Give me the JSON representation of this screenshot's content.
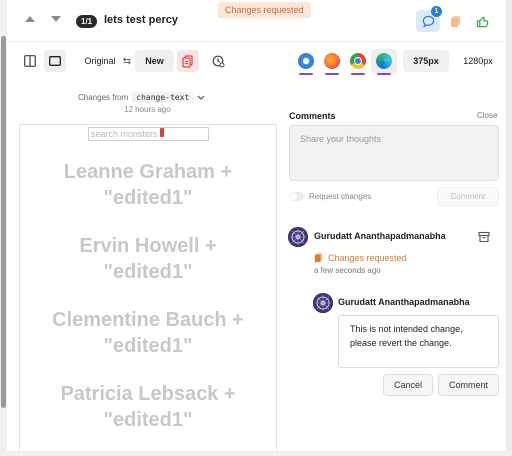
{
  "header": {
    "counter": "1/1",
    "title": "lets test percy",
    "status": "Changes requested",
    "notification_count": "1"
  },
  "toolbar": {
    "original_label": "Original",
    "new_label": "New",
    "width_options": [
      "375px",
      "1280px"
    ],
    "browsers": [
      "safari-icon",
      "firefox-icon",
      "chrome-icon",
      "edge-icon"
    ]
  },
  "changes": {
    "prefix": "Changes from",
    "branch": "change-text",
    "time": "12 hours ago"
  },
  "snapshot": {
    "search_placeholder": "search monsters",
    "names": [
      "Leanne Graham + \"edited1\"",
      "Ervin Howell + \"edited1\"",
      "Clementine Bauch + \"edited1\"",
      "Patricia Lebsack + \"edited1\""
    ]
  },
  "comments": {
    "title": "Comments",
    "close_label": "Close",
    "placeholder": "Share your thoughts",
    "request_changes_label": "Request changes",
    "comment_button": "Comment",
    "thread": {
      "author": "Gurudatt Ananthapadmanabha",
      "status": "Changes requested",
      "timestamp": "a few seconds ago",
      "reply_author": "Gurudatt Ananthapadmanabha",
      "reply_text": "This is not intended change, please revert the change.",
      "cancel_label": "Cancel",
      "submit_label": "Comment"
    }
  },
  "colors": {
    "accent_orange": "#e07a30",
    "badge_bg": "#fde6d8",
    "active_blue": "#2a7de1",
    "browser_underline": "#7b4fcf"
  }
}
